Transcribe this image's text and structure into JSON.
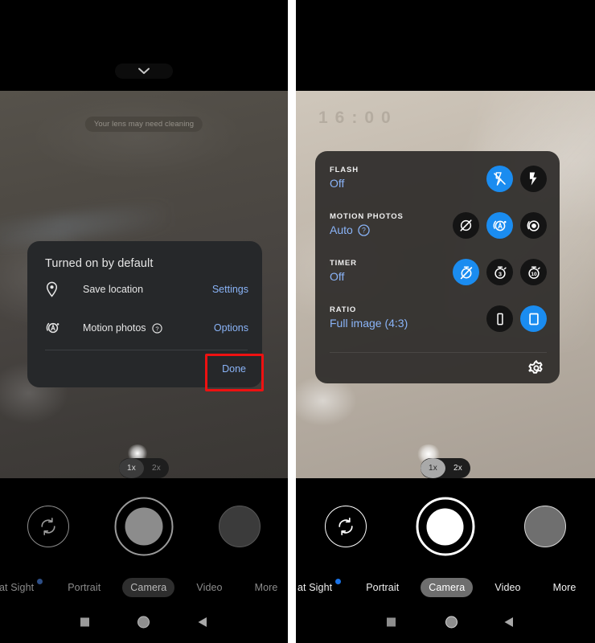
{
  "left_screen": {
    "top_pill_icon": "chevron-down-icon",
    "toast": "Your lens may need cleaning",
    "dialog": {
      "title": "Turned on by default",
      "rows": [
        {
          "icon": "location-pin-icon",
          "label": "Save location",
          "help": "",
          "action": "Settings"
        },
        {
          "icon": "motion-photo-auto-icon",
          "label": "Motion photos",
          "help": "?",
          "action": "Options"
        }
      ],
      "done_label": "Done",
      "highlight_color": "#ee1111",
      "link_color": "#8ab4f8"
    },
    "zoom": {
      "options": [
        "1x",
        "2x"
      ],
      "selected": "1x"
    },
    "controls": {
      "switch_camera_icon": "camera-switch-icon",
      "shutter_icon": "shutter-button",
      "gallery_icon": "gallery-thumbnail"
    },
    "modes": [
      {
        "label": "at Sight",
        "selected": false,
        "dot": true
      },
      {
        "label": "Portrait",
        "selected": false,
        "dot": false
      },
      {
        "label": "Camera",
        "selected": true,
        "dot": false
      },
      {
        "label": "Video",
        "selected": false,
        "dot": false
      },
      {
        "label": "More",
        "selected": false,
        "dot": false
      }
    ],
    "navbar": [
      "recents-square-icon",
      "home-circle-icon",
      "back-triangle-icon"
    ]
  },
  "right_screen": {
    "ghost_text": "16:00",
    "settings_sheet": {
      "rows": [
        {
          "caption": "FLASH",
          "value": "Off",
          "help": "",
          "options": [
            {
              "icon": "flash-off-icon",
              "active": true
            },
            {
              "icon": "flash-on-icon",
              "active": false
            }
          ]
        },
        {
          "caption": "MOTION PHOTOS",
          "value": "Auto",
          "help": "?",
          "options": [
            {
              "icon": "motion-off-icon",
              "active": false
            },
            {
              "icon": "motion-auto-icon",
              "active": true
            },
            {
              "icon": "motion-on-icon",
              "active": false
            }
          ]
        },
        {
          "caption": "TIMER",
          "value": "Off",
          "help": "",
          "options": [
            {
              "icon": "timer-off-icon",
              "active": true
            },
            {
              "icon": "timer-3s-icon",
              "active": false
            },
            {
              "icon": "timer-10s-icon",
              "active": false
            }
          ]
        },
        {
          "caption": "RATIO",
          "value": "Full image (4:3)",
          "help": "",
          "options": [
            {
              "icon": "ratio-16-9-icon",
              "active": false
            },
            {
              "icon": "ratio-4-3-icon",
              "active": true
            }
          ]
        }
      ],
      "gear_icon": "gear-icon",
      "accent_color": "#1a8cf0",
      "value_color": "#8ab4f8"
    },
    "zoom": {
      "options": [
        "1x",
        "2x"
      ],
      "selected": "1x"
    },
    "controls": {
      "switch_camera_icon": "camera-switch-icon",
      "shutter_icon": "shutter-button",
      "gallery_icon": "gallery-thumbnail"
    },
    "modes": [
      {
        "label": "at Sight",
        "selected": false,
        "dot": true
      },
      {
        "label": "Portrait",
        "selected": false,
        "dot": false
      },
      {
        "label": "Camera",
        "selected": true,
        "dot": false
      },
      {
        "label": "Video",
        "selected": false,
        "dot": false
      },
      {
        "label": "More",
        "selected": false,
        "dot": false
      }
    ],
    "navbar": [
      "recents-square-icon",
      "home-circle-icon",
      "back-triangle-icon"
    ]
  }
}
